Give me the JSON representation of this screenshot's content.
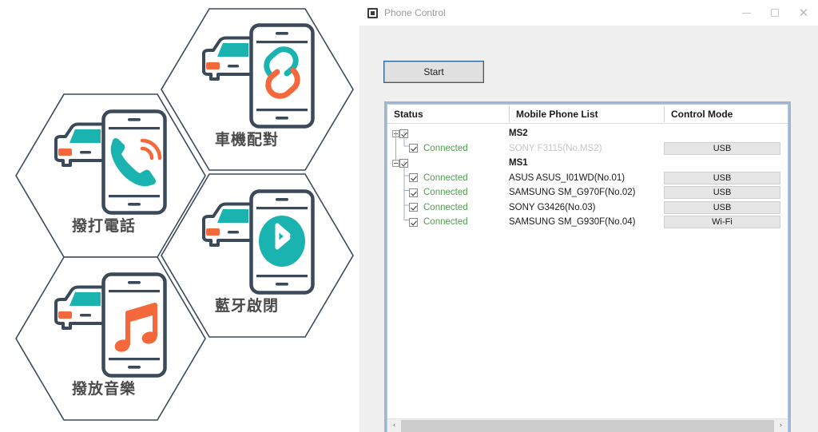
{
  "infographic": {
    "hexagons": [
      {
        "id": "pair",
        "label": "車機配對",
        "icon": "link-icon"
      },
      {
        "id": "call",
        "label": "撥打電話",
        "icon": "phone-call-icon"
      },
      {
        "id": "bluetooth",
        "label": "藍牙啟閉",
        "icon": "bluetooth-icon"
      },
      {
        "id": "music",
        "label": "撥放音樂",
        "icon": "music-note-icon"
      }
    ],
    "colors": {
      "outline": "#3b4a5a",
      "teal": "#1bb3b0",
      "orange": "#f4683c",
      "label_text": "#4a4a4a"
    }
  },
  "window": {
    "title": "Phone Control",
    "app_icon": "app-square-icon",
    "controls": {
      "minimize": "minimize-icon",
      "maximize": "maximize-icon",
      "close": "close-icon"
    },
    "toolbar": {
      "start_label": "Start"
    },
    "list": {
      "columns": [
        "Status",
        "Mobile Phone List",
        "Control Mode"
      ],
      "rows": [
        {
          "kind": "group",
          "expander": "collapse-minus",
          "checked": true,
          "status": "",
          "name": "MS2",
          "name_style": "bold",
          "mode": ""
        },
        {
          "kind": "child",
          "expander": "",
          "checked": true,
          "status": "Connected",
          "name": "SONY F3115(No.MS2)",
          "name_style": "dimmed",
          "mode": "USB",
          "last_child": true
        },
        {
          "kind": "group",
          "expander": "collapse-minus",
          "checked": true,
          "status": "",
          "name": "MS1",
          "name_style": "bold",
          "mode": ""
        },
        {
          "kind": "child",
          "expander": "",
          "checked": true,
          "status": "Connected",
          "name": "ASUS ASUS_I01WD(No.01)",
          "name_style": "normal",
          "mode": "USB",
          "last_child": false
        },
        {
          "kind": "child",
          "expander": "",
          "checked": true,
          "status": "Connected",
          "name": "SAMSUNG SM_G970F(No.02)",
          "name_style": "normal",
          "mode": "USB",
          "last_child": false
        },
        {
          "kind": "child",
          "expander": "",
          "checked": true,
          "status": "Connected",
          "name": "SONY G3426(No.03)",
          "name_style": "normal",
          "mode": "USB",
          "last_child": false
        },
        {
          "kind": "child",
          "expander": "",
          "checked": true,
          "status": "Connected",
          "name": "SAMSUNG SM_G930F(No.04)",
          "name_style": "normal",
          "mode": "Wi-Fi",
          "last_child": true
        }
      ]
    },
    "scrollbar": {
      "left_arrow": "‹",
      "right_arrow": "›"
    },
    "colors": {
      "titlebar_bg": "#ffffff",
      "client_bg": "#f0f0f0",
      "frame_border": "#9fb6d2",
      "focus_outline": "#2a6496",
      "connected_text": "#4f9d4f",
      "dimmed_text": "#c6c6c6"
    }
  }
}
